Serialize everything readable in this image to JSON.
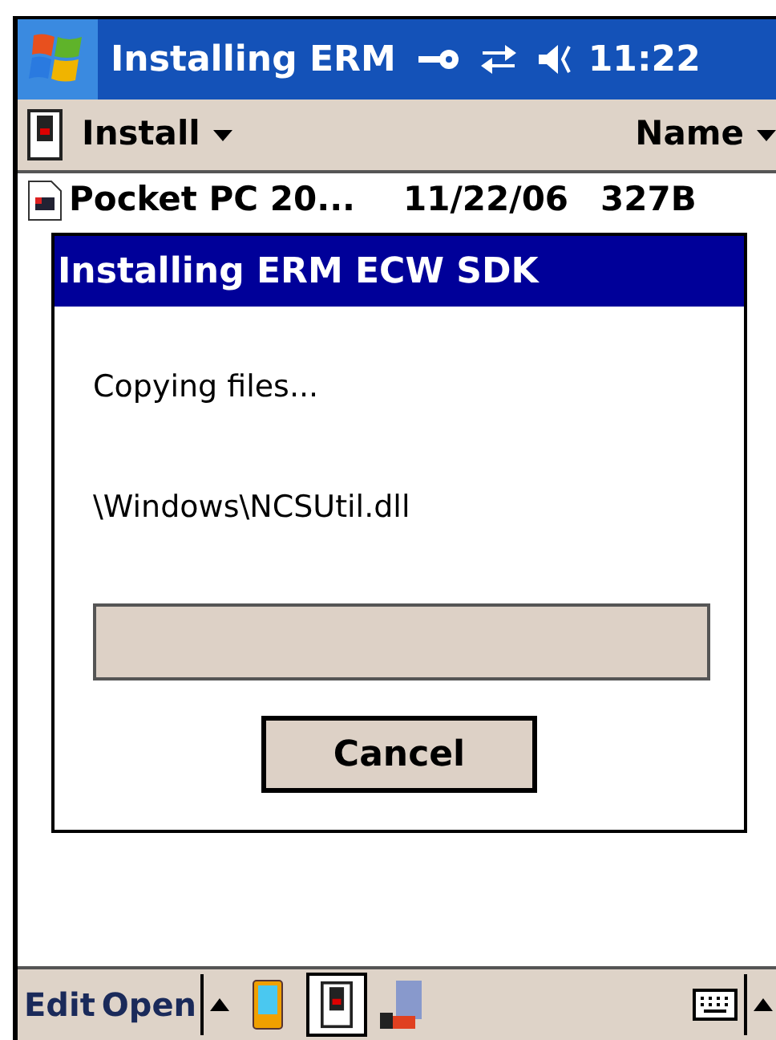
{
  "title_bar": {
    "title": "Installing ERM",
    "time": "11:22"
  },
  "toolbar": {
    "menu": "Install",
    "sort": "Name"
  },
  "files": [
    {
      "name": "Pocket PC 20...",
      "date": "11/22/06",
      "size": "327B"
    }
  ],
  "dialog": {
    "title": "Installing ERM ECW SDK",
    "status": "Copying files...",
    "file": "\\Windows\\NCSUtil.dll",
    "progress": {
      "level": 0
    },
    "button": "Cancel"
  },
  "menu_bar": {
    "items": [
      "Edit",
      "Open"
    ]
  }
}
